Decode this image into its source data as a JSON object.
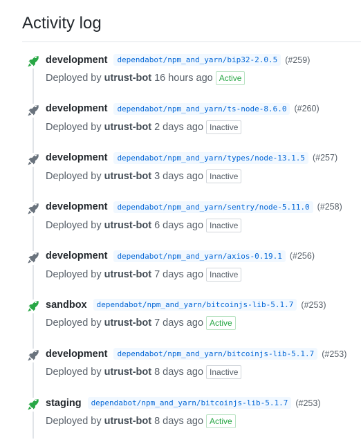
{
  "page": {
    "title": "Activity log"
  },
  "colors": {
    "active_green": "#28a745",
    "inactive_gray": "#6a737d",
    "link_blue": "#0366d6"
  },
  "entries": [
    {
      "environment": "development",
      "ref": "dependabot/npm_and_yarn/bip32-2.0.5",
      "pr": "(#259)",
      "deployed_by": "Deployed by",
      "user": "utrust-bot",
      "time": "16 hours ago",
      "status": "Active",
      "icon": "rocket-icon"
    },
    {
      "environment": "development",
      "ref": "dependabot/npm_and_yarn/ts-node-8.6.0",
      "pr": "(#260)",
      "deployed_by": "Deployed by",
      "user": "utrust-bot",
      "time": "2 days ago",
      "status": "Inactive",
      "icon": "rocket-icon"
    },
    {
      "environment": "development",
      "ref": "dependabot/npm_and_yarn/types/node-13.1.5",
      "pr": "(#257)",
      "deployed_by": "Deployed by",
      "user": "utrust-bot",
      "time": "3 days ago",
      "status": "Inactive",
      "icon": "rocket-icon"
    },
    {
      "environment": "development",
      "ref": "dependabot/npm_and_yarn/sentry/node-5.11.0",
      "pr": "(#258)",
      "deployed_by": "Deployed by",
      "user": "utrust-bot",
      "time": "6 days ago",
      "status": "Inactive",
      "icon": "rocket-icon"
    },
    {
      "environment": "development",
      "ref": "dependabot/npm_and_yarn/axios-0.19.1",
      "pr": "(#256)",
      "deployed_by": "Deployed by",
      "user": "utrust-bot",
      "time": "7 days ago",
      "status": "Inactive",
      "icon": "rocket-icon"
    },
    {
      "environment": "sandbox",
      "ref": "dependabot/npm_and_yarn/bitcoinjs-lib-5.1.7",
      "pr": "(#253)",
      "deployed_by": "Deployed by",
      "user": "utrust-bot",
      "time": "7 days ago",
      "status": "Active",
      "icon": "rocket-icon"
    },
    {
      "environment": "development",
      "ref": "dependabot/npm_and_yarn/bitcoinjs-lib-5.1.7",
      "pr": "(#253)",
      "deployed_by": "Deployed by",
      "user": "utrust-bot",
      "time": "8 days ago",
      "status": "Inactive",
      "icon": "rocket-icon"
    },
    {
      "environment": "staging",
      "ref": "dependabot/npm_and_yarn/bitcoinjs-lib-5.1.7",
      "pr": "(#253)",
      "deployed_by": "Deployed by",
      "user": "utrust-bot",
      "time": "8 days ago",
      "status": "Active",
      "icon": "rocket-icon"
    }
  ]
}
